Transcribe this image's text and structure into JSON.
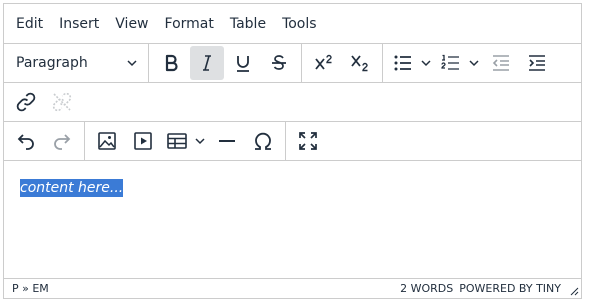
{
  "menubar": {
    "items": [
      {
        "label": "Edit"
      },
      {
        "label": "Insert"
      },
      {
        "label": "View"
      },
      {
        "label": "Format"
      },
      {
        "label": "Table"
      },
      {
        "label": "Tools"
      }
    ]
  },
  "toolbar": {
    "block_format": "Paragraph",
    "bold_icon": "bold-icon",
    "italic_active": true,
    "link_disabled": false,
    "unlink_disabled": true,
    "redo_disabled": true
  },
  "content": {
    "text": "content here..."
  },
  "statusbar": {
    "path": "P » EM",
    "word_count": "2 WORDS",
    "powered_by": "POWERED BY TINY"
  },
  "colors": {
    "border": "#cccccc",
    "text": "#222f3e",
    "selection": "#3b7bd6",
    "active_button": "#dee0e2"
  }
}
